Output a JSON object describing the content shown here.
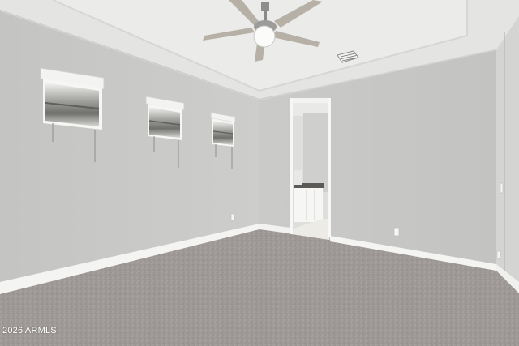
{
  "photo": {
    "subject": "empty-bedroom",
    "watermark": "2026 ARMLS",
    "colors": {
      "wall": "#c9c9c7",
      "ceiling": "#e6e6e4",
      "carpet": "#9e9996",
      "trim": "#f4f4f2"
    }
  }
}
